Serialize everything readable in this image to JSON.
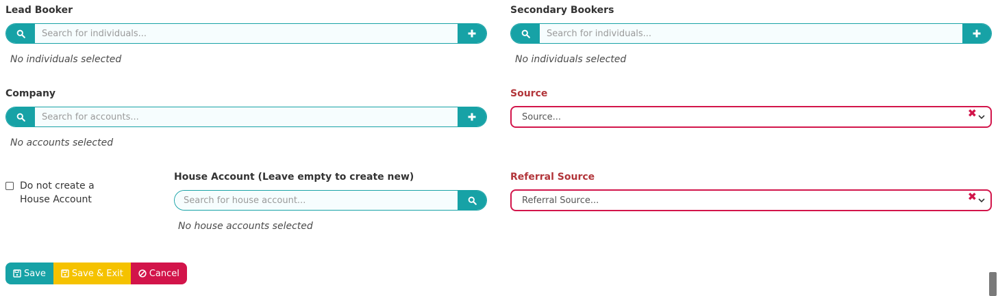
{
  "lead_booker": {
    "label": "Lead Booker",
    "placeholder": "Search for individuals...",
    "empty_text": "No individuals selected"
  },
  "secondary_bookers": {
    "label": "Secondary Bookers",
    "placeholder": "Search for individuals...",
    "empty_text": "No individuals selected"
  },
  "company": {
    "label": "Company",
    "placeholder": "Search for accounts...",
    "empty_text": "No accounts selected"
  },
  "source": {
    "label": "Source",
    "placeholder": "Source..."
  },
  "house_account": {
    "checkbox_label": "Do not create a House Account",
    "checked": false,
    "label": "House Account (Leave empty to create new)",
    "placeholder": "Search for house account...",
    "empty_text": "No house accounts selected"
  },
  "referral_source": {
    "label": "Referral Source",
    "placeholder": "Referral Source..."
  },
  "actions": {
    "save": "Save",
    "save_exit": "Save & Exit",
    "cancel": "Cancel"
  },
  "colors": {
    "teal": "#17a2a6",
    "yellow": "#f5c200",
    "danger": "#d2144a",
    "required_label": "#b2353a"
  },
  "icons": [
    "search-icon",
    "plus-icon",
    "clear-icon",
    "chevron-down-icon",
    "save-icon",
    "cancel-icon"
  ]
}
